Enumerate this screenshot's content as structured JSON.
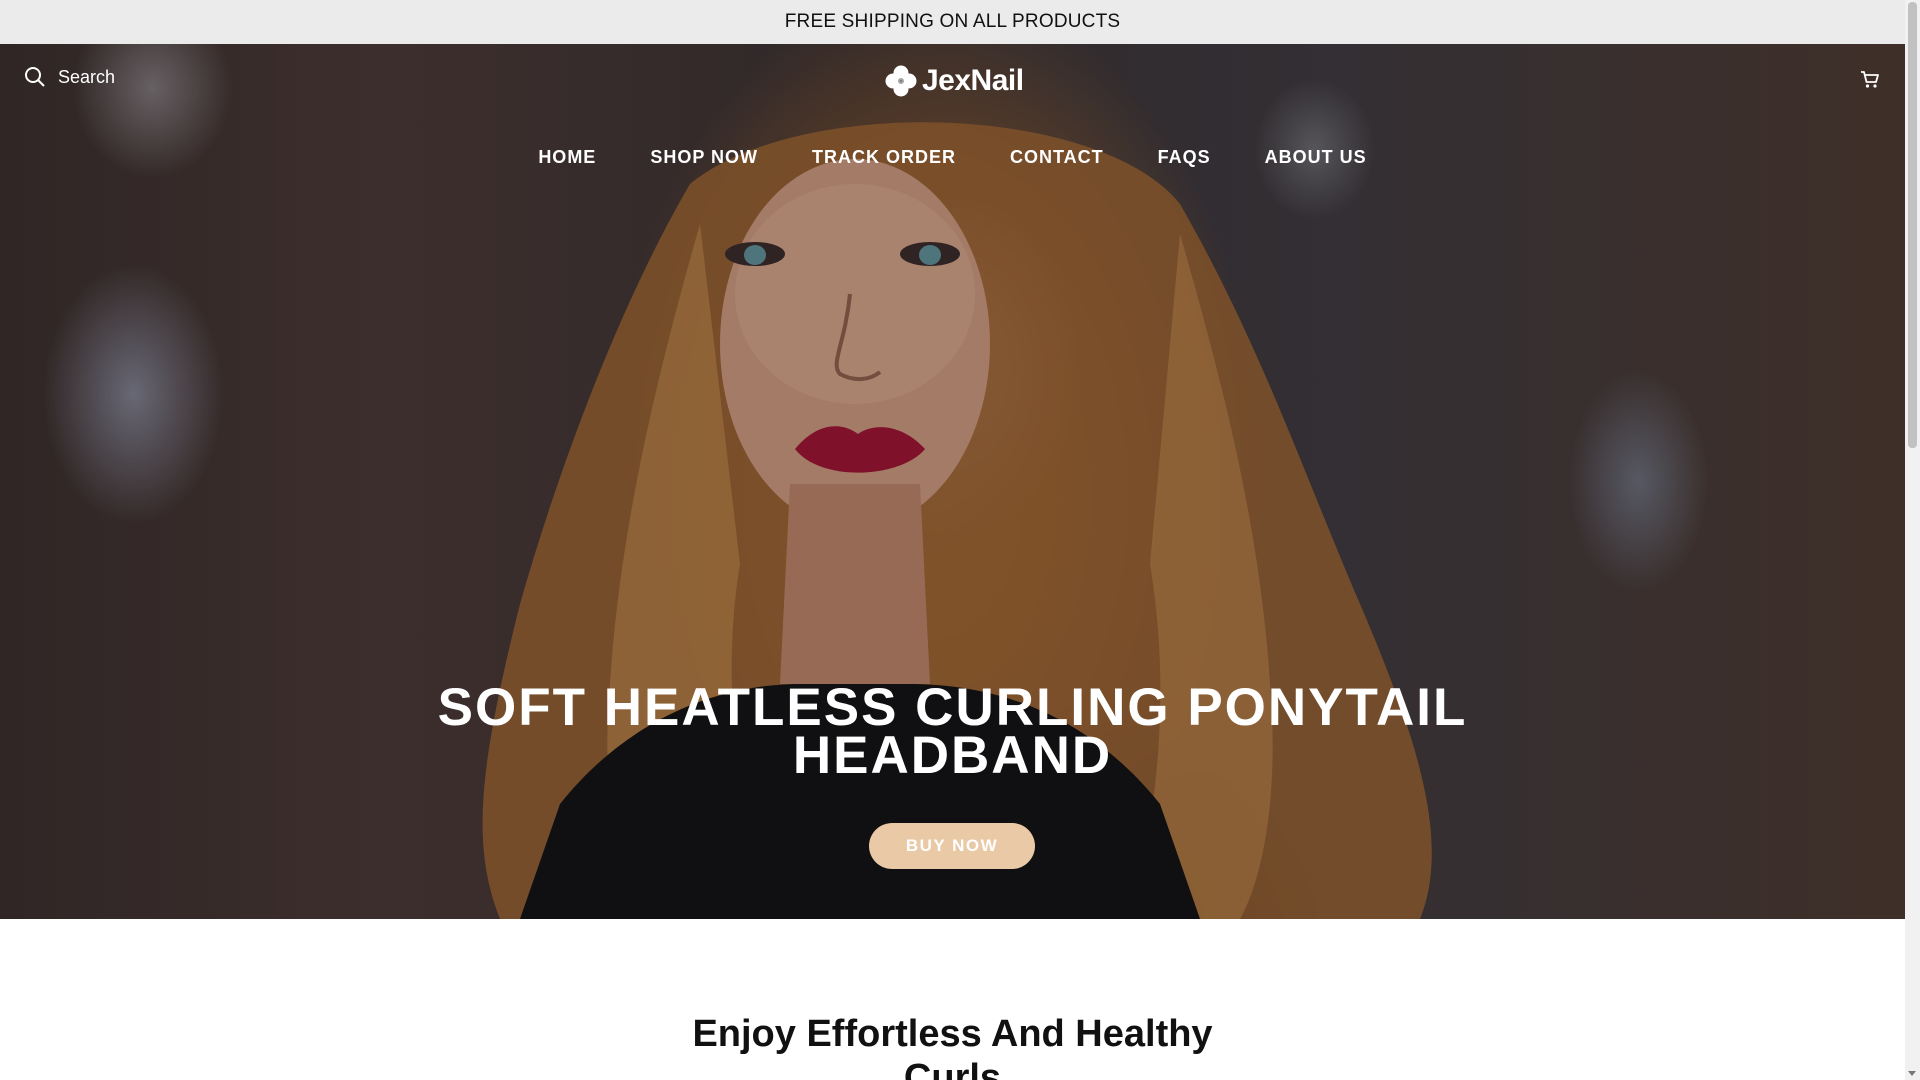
{
  "announcement": {
    "text": "FREE SHIPPING ON ALL PRODUCTS"
  },
  "header": {
    "search_label": "Search",
    "logo_text": "JexNail",
    "icons": {
      "search": "search-icon",
      "cart": "cart-icon",
      "logo": "clover-logo-icon"
    }
  },
  "nav": {
    "items": [
      {
        "label": "HOME"
      },
      {
        "label": "SHOP NOW"
      },
      {
        "label": "TRACK ORDER"
      },
      {
        "label": "CONTACT"
      },
      {
        "label": "FAQS"
      },
      {
        "label": "ABOUT US"
      }
    ]
  },
  "hero": {
    "title_line1": "SOFT HEATLESS CURLING PONYTAIL",
    "title_line2": "HEADBAND",
    "button_label": "BUY NOW",
    "button_color": "#e9c9a6"
  },
  "section": {
    "title_line1": "Enjoy Effortless And Healthy",
    "title_line2": "Curls"
  }
}
